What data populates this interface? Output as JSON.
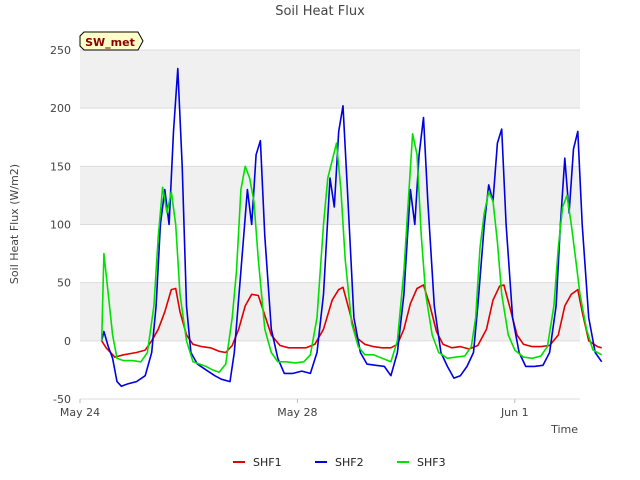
{
  "chart_data": {
    "type": "line",
    "title": "Soil Heat Flux",
    "xlabel": "Time",
    "ylabel": "Soil Heat Flux (W/m2)",
    "badge": "SW_met",
    "xlim": [
      0,
      11.5
    ],
    "ylim": [
      -50,
      250
    ],
    "yticks": [
      -50,
      0,
      50,
      100,
      150,
      200,
      250
    ],
    "xticks": [
      {
        "value": 0,
        "label": "May 24"
      },
      {
        "value": 5,
        "label": "May 28"
      },
      {
        "value": 10,
        "label": "Jun 1"
      }
    ],
    "grid": true,
    "legend_position": "bottom",
    "series": [
      {
        "name": "SHF1",
        "color": "#e00000",
        "points": [
          [
            0.5,
            0
          ],
          [
            0.6,
            -6
          ],
          [
            0.8,
            -14
          ],
          [
            1.0,
            -12
          ],
          [
            1.3,
            -10
          ],
          [
            1.5,
            -8
          ],
          [
            1.65,
            0
          ],
          [
            1.8,
            10
          ],
          [
            1.95,
            25
          ],
          [
            2.1,
            44
          ],
          [
            2.2,
            45
          ],
          [
            2.3,
            25
          ],
          [
            2.45,
            5
          ],
          [
            2.6,
            -3
          ],
          [
            2.8,
            -5
          ],
          [
            3.0,
            -6
          ],
          [
            3.2,
            -9
          ],
          [
            3.35,
            -10
          ],
          [
            3.5,
            -4
          ],
          [
            3.65,
            10
          ],
          [
            3.8,
            30
          ],
          [
            3.95,
            40
          ],
          [
            4.1,
            39
          ],
          [
            4.25,
            22
          ],
          [
            4.4,
            5
          ],
          [
            4.6,
            -4
          ],
          [
            4.8,
            -6
          ],
          [
            5.0,
            -6
          ],
          [
            5.2,
            -6
          ],
          [
            5.4,
            -3
          ],
          [
            5.6,
            10
          ],
          [
            5.8,
            35
          ],
          [
            5.95,
            44
          ],
          [
            6.05,
            46
          ],
          [
            6.2,
            25
          ],
          [
            6.35,
            3
          ],
          [
            6.55,
            -3
          ],
          [
            6.75,
            -5
          ],
          [
            6.95,
            -6
          ],
          [
            7.15,
            -6
          ],
          [
            7.3,
            -3
          ],
          [
            7.45,
            10
          ],
          [
            7.6,
            32
          ],
          [
            7.75,
            45
          ],
          [
            7.9,
            48
          ],
          [
            8.05,
            30
          ],
          [
            8.2,
            8
          ],
          [
            8.35,
            -3
          ],
          [
            8.55,
            -6
          ],
          [
            8.75,
            -5
          ],
          [
            8.95,
            -7
          ],
          [
            9.15,
            -4
          ],
          [
            9.35,
            10
          ],
          [
            9.5,
            35
          ],
          [
            9.65,
            47
          ],
          [
            9.75,
            48
          ],
          [
            9.9,
            27
          ],
          [
            10.05,
            5
          ],
          [
            10.2,
            -3
          ],
          [
            10.4,
            -5
          ],
          [
            10.6,
            -5
          ],
          [
            10.8,
            -4
          ],
          [
            11.0,
            5
          ],
          [
            11.15,
            30
          ],
          [
            11.3,
            40
          ],
          [
            11.45,
            44
          ],
          [
            11.55,
            25
          ],
          [
            11.7,
            0
          ],
          [
            11.9,
            -5
          ],
          [
            12.0,
            -6
          ]
        ]
      },
      {
        "name": "SHF2",
        "color": "#0000e0",
        "points": [
          [
            0.5,
            0
          ],
          [
            0.55,
            8
          ],
          [
            0.65,
            -5
          ],
          [
            0.75,
            -15
          ],
          [
            0.85,
            -35
          ],
          [
            0.95,
            -39
          ],
          [
            1.1,
            -37
          ],
          [
            1.3,
            -35
          ],
          [
            1.5,
            -30
          ],
          [
            1.65,
            -10
          ],
          [
            1.75,
            30
          ],
          [
            1.85,
            100
          ],
          [
            1.95,
            130
          ],
          [
            2.05,
            100
          ],
          [
            2.15,
            180
          ],
          [
            2.25,
            234
          ],
          [
            2.35,
            150
          ],
          [
            2.45,
            30
          ],
          [
            2.55,
            -10
          ],
          [
            2.7,
            -20
          ],
          [
            2.9,
            -25
          ],
          [
            3.1,
            -30
          ],
          [
            3.25,
            -33
          ],
          [
            3.45,
            -35
          ],
          [
            3.55,
            -10
          ],
          [
            3.7,
            60
          ],
          [
            3.85,
            130
          ],
          [
            3.95,
            100
          ],
          [
            4.05,
            160
          ],
          [
            4.15,
            172
          ],
          [
            4.25,
            90
          ],
          [
            4.4,
            10
          ],
          [
            4.55,
            -15
          ],
          [
            4.7,
            -28
          ],
          [
            4.9,
            -28
          ],
          [
            5.1,
            -26
          ],
          [
            5.3,
            -28
          ],
          [
            5.45,
            -10
          ],
          [
            5.6,
            40
          ],
          [
            5.75,
            140
          ],
          [
            5.85,
            115
          ],
          [
            5.95,
            180
          ],
          [
            6.05,
            202
          ],
          [
            6.15,
            130
          ],
          [
            6.3,
            20
          ],
          [
            6.45,
            -10
          ],
          [
            6.6,
            -20
          ],
          [
            6.8,
            -21
          ],
          [
            7.0,
            -22
          ],
          [
            7.15,
            -30
          ],
          [
            7.3,
            -10
          ],
          [
            7.45,
            40
          ],
          [
            7.6,
            130
          ],
          [
            7.7,
            100
          ],
          [
            7.8,
            160
          ],
          [
            7.9,
            192
          ],
          [
            8.0,
            120
          ],
          [
            8.15,
            30
          ],
          [
            8.3,
            -10
          ],
          [
            8.45,
            -22
          ],
          [
            8.6,
            -32
          ],
          [
            8.75,
            -30
          ],
          [
            8.9,
            -22
          ],
          [
            9.05,
            -10
          ],
          [
            9.15,
            30
          ],
          [
            9.3,
            100
          ],
          [
            9.4,
            134
          ],
          [
            9.5,
            120
          ],
          [
            9.6,
            170
          ],
          [
            9.7,
            182
          ],
          [
            9.8,
            100
          ],
          [
            9.95,
            20
          ],
          [
            10.1,
            -10
          ],
          [
            10.25,
            -22
          ],
          [
            10.45,
            -22
          ],
          [
            10.65,
            -21
          ],
          [
            10.8,
            -10
          ],
          [
            10.95,
            30
          ],
          [
            11.05,
            100
          ],
          [
            11.15,
            157
          ],
          [
            11.25,
            110
          ],
          [
            11.35,
            165
          ],
          [
            11.45,
            180
          ],
          [
            11.55,
            100
          ],
          [
            11.7,
            20
          ],
          [
            11.85,
            -10
          ],
          [
            12.0,
            -18
          ]
        ]
      },
      {
        "name": "SHF3",
        "color": "#00e000",
        "points": [
          [
            0.5,
            0
          ],
          [
            0.55,
            75
          ],
          [
            0.65,
            40
          ],
          [
            0.75,
            5
          ],
          [
            0.85,
            -15
          ],
          [
            1.0,
            -17
          ],
          [
            1.2,
            -17
          ],
          [
            1.4,
            -18
          ],
          [
            1.55,
            -10
          ],
          [
            1.7,
            30
          ],
          [
            1.8,
            90
          ],
          [
            1.9,
            132
          ],
          [
            2.0,
            110
          ],
          [
            2.1,
            128
          ],
          [
            2.2,
            100
          ],
          [
            2.3,
            40
          ],
          [
            2.45,
            0
          ],
          [
            2.6,
            -18
          ],
          [
            2.75,
            -20
          ],
          [
            2.9,
            -22
          ],
          [
            3.05,
            -25
          ],
          [
            3.2,
            -27
          ],
          [
            3.35,
            -20
          ],
          [
            3.5,
            20
          ],
          [
            3.6,
            60
          ],
          [
            3.7,
            130
          ],
          [
            3.8,
            150
          ],
          [
            3.9,
            140
          ],
          [
            4.0,
            120
          ],
          [
            4.1,
            70
          ],
          [
            4.25,
            10
          ],
          [
            4.4,
            -10
          ],
          [
            4.55,
            -18
          ],
          [
            4.75,
            -18
          ],
          [
            4.95,
            -19
          ],
          [
            5.15,
            -18
          ],
          [
            5.3,
            -12
          ],
          [
            5.45,
            20
          ],
          [
            5.6,
            100
          ],
          [
            5.7,
            140
          ],
          [
            5.8,
            155
          ],
          [
            5.9,
            170
          ],
          [
            6.0,
            130
          ],
          [
            6.1,
            70
          ],
          [
            6.25,
            15
          ],
          [
            6.4,
            -5
          ],
          [
            6.55,
            -12
          ],
          [
            6.75,
            -12
          ],
          [
            6.95,
            -15
          ],
          [
            7.15,
            -18
          ],
          [
            7.3,
            0
          ],
          [
            7.45,
            60
          ],
          [
            7.55,
            120
          ],
          [
            7.65,
            178
          ],
          [
            7.75,
            160
          ],
          [
            7.85,
            90
          ],
          [
            7.95,
            40
          ],
          [
            8.1,
            5
          ],
          [
            8.25,
            -10
          ],
          [
            8.45,
            -15
          ],
          [
            8.65,
            -14
          ],
          [
            8.85,
            -13
          ],
          [
            9.0,
            -5
          ],
          [
            9.1,
            20
          ],
          [
            9.2,
            80
          ],
          [
            9.3,
            110
          ],
          [
            9.4,
            128
          ],
          [
            9.5,
            120
          ],
          [
            9.6,
            85
          ],
          [
            9.7,
            40
          ],
          [
            9.85,
            5
          ],
          [
            10.0,
            -8
          ],
          [
            10.2,
            -14
          ],
          [
            10.4,
            -15
          ],
          [
            10.6,
            -13
          ],
          [
            10.75,
            -5
          ],
          [
            10.9,
            30
          ],
          [
            11.0,
            80
          ],
          [
            11.1,
            115
          ],
          [
            11.2,
            125
          ],
          [
            11.3,
            100
          ],
          [
            11.4,
            70
          ],
          [
            11.5,
            40
          ],
          [
            11.65,
            10
          ],
          [
            11.8,
            -8
          ],
          [
            12.0,
            -12
          ]
        ]
      }
    ]
  }
}
